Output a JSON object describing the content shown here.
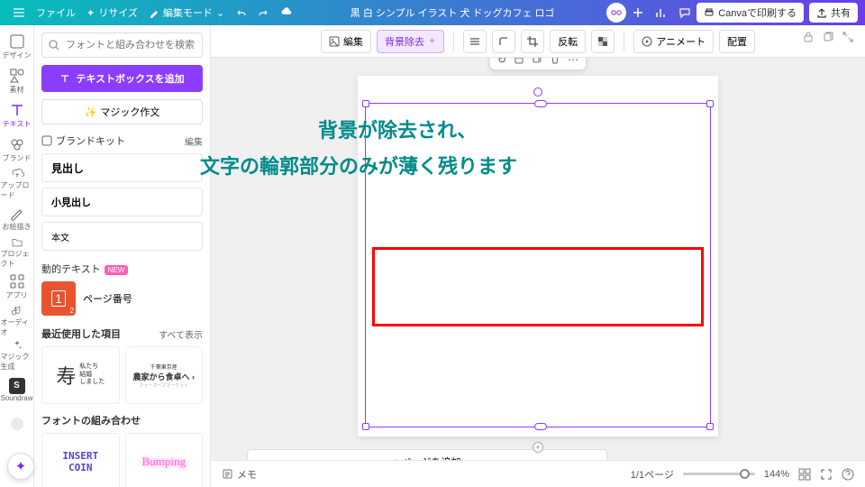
{
  "topbar": {
    "file": "ファイル",
    "resize": "リサイズ",
    "edit_mode": "編集モード",
    "title": "黒 白 シンプル イラスト 犬 ドッグカフェ ロゴ",
    "print": "Canvaで印刷する",
    "share": "共有"
  },
  "rail": [
    {
      "label": "デザイン"
    },
    {
      "label": "素材"
    },
    {
      "label": "テキスト"
    },
    {
      "label": "ブランド"
    },
    {
      "label": "アップロード"
    },
    {
      "label": "お絵描き"
    },
    {
      "label": "プロジェクト"
    },
    {
      "label": "アプリ"
    },
    {
      "label": "オーディオ"
    },
    {
      "label": "マジック生成"
    },
    {
      "label": "Soundraw"
    }
  ],
  "panel": {
    "search_placeholder": "フォントと組み合わせを検索",
    "add_textbox": "テキストボックスを追加",
    "magic_write": "マジック作文",
    "brandkit": "ブランドキット",
    "edit": "編集",
    "heading": "見出し",
    "subheading": "小見出し",
    "body": "本文",
    "dynamic_text": "動的テキスト",
    "new": "NEW",
    "page_number": "ページ番号",
    "recent": "最近使用した項目",
    "show_all": "すべて表示",
    "thumb1_a": "寿",
    "thumb1_b": "私たち\n結婚\nしました",
    "thumb2_a": "千葉東京産",
    "thumb2_b": "農家から食卓へ ›",
    "font_combo": "フォントの組み合わせ",
    "thumb3": "INSERT\nCOIN",
    "thumb4": "Bumping"
  },
  "ctx": {
    "edit": "編集",
    "bg_remove": "背景除去",
    "flip": "反転",
    "animate": "アニメート",
    "position": "配置"
  },
  "overlay": {
    "line1": "背景が除去され、",
    "line2": "文字の輪郭部分のみが薄く残ります"
  },
  "canvas": {
    "add_page": "+ ページを追加"
  },
  "bottom": {
    "memo": "メモ",
    "pages": "1/1ページ",
    "zoom": "144%"
  }
}
